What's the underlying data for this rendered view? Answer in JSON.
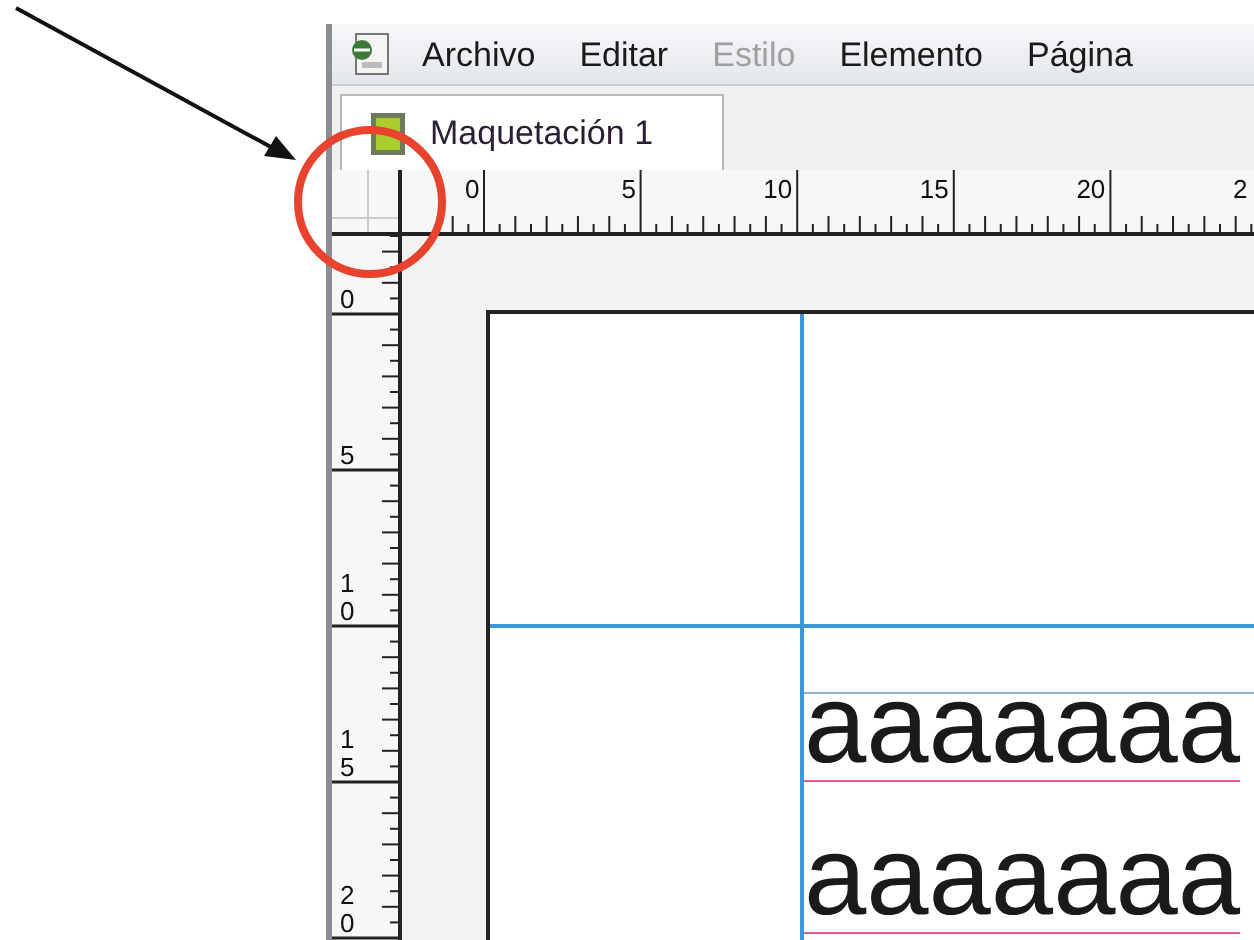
{
  "menu": [
    {
      "label": "Archivo",
      "disabled": false
    },
    {
      "label": "Editar",
      "disabled": false
    },
    {
      "label": "Estilo",
      "disabled": true
    },
    {
      "label": "Elemento",
      "disabled": false
    },
    {
      "label": "Página",
      "disabled": false
    }
  ],
  "tabs": [
    {
      "label": "Maquetación 1",
      "selected": true
    }
  ],
  "rulers": {
    "horizontal": [
      "0",
      "5",
      "10",
      "15",
      "20",
      "2"
    ],
    "vertical": [
      "0",
      "5",
      "10",
      "15",
      "20"
    ]
  },
  "text_frame": {
    "lines": [
      "aaaaaaa",
      "aaaaaaa"
    ]
  }
}
